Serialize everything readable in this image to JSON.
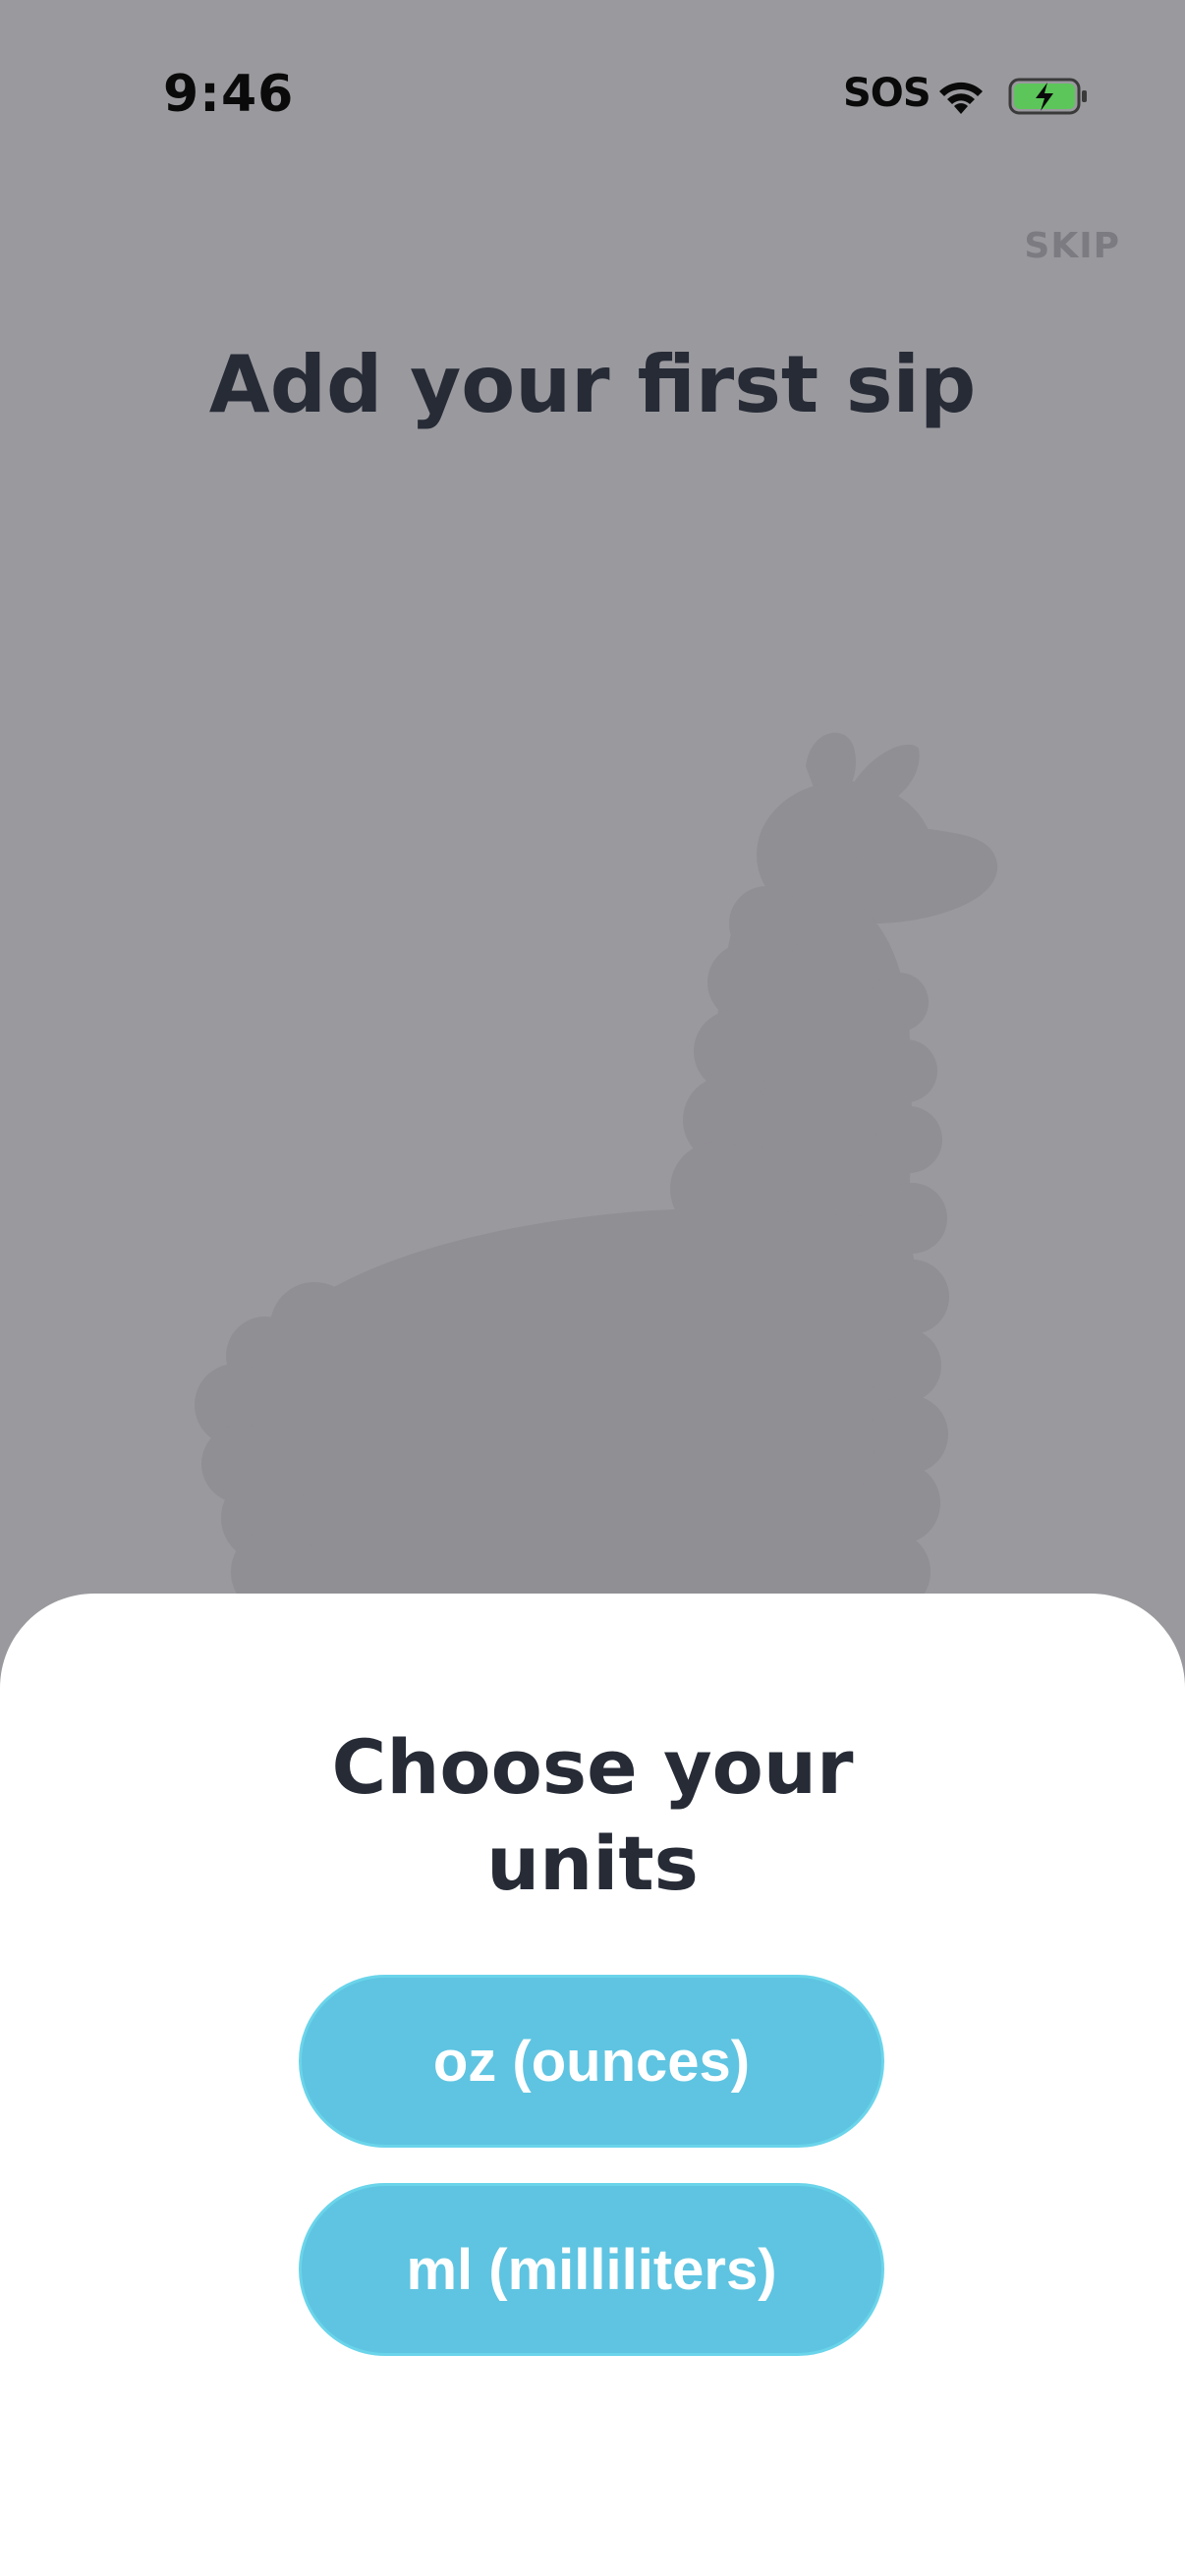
{
  "status_bar": {
    "time": "9:46",
    "carrier": "SOS",
    "icons": [
      "wifi-icon",
      "battery-charging-icon"
    ],
    "battery_color": "#5cc65a"
  },
  "header": {
    "skip_label": "SKIP",
    "title": "Add your first sip"
  },
  "illustration": {
    "icon": "llama-silhouette"
  },
  "sheet": {
    "title_line1": "Choose your",
    "title_line2": "units",
    "options": [
      {
        "label": "oz (ounces)"
      },
      {
        "label": "ml (milliliters)"
      }
    ]
  },
  "colors": {
    "overlay_background": "#9a999e",
    "accent": "#5ec4e1",
    "title_text": "#262b36",
    "sheet_background": "#ffffff"
  }
}
